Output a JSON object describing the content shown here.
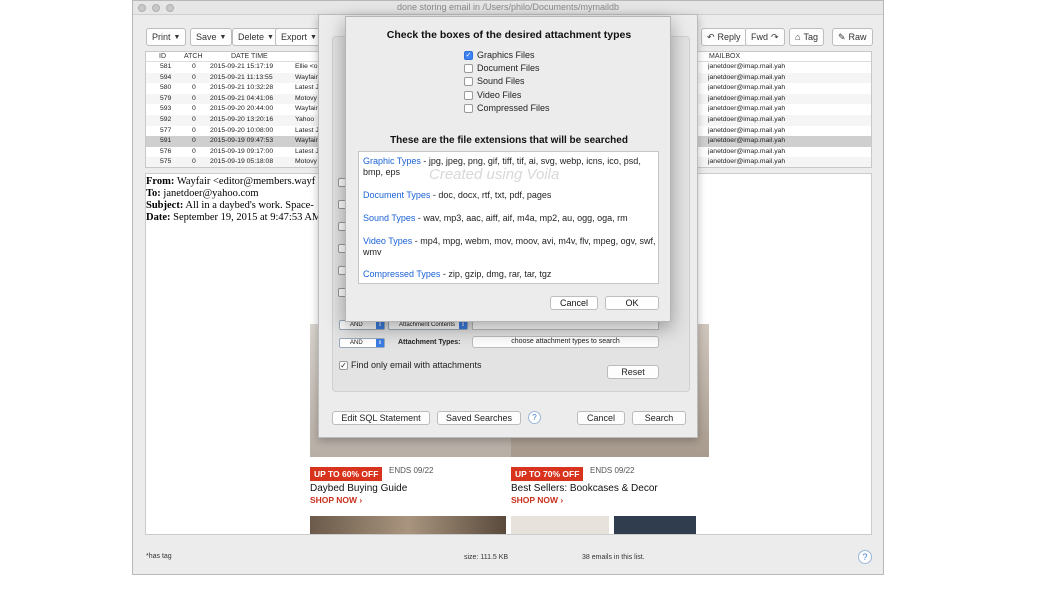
{
  "window": {
    "title": "done storing email in /Users/philo/Documents/mymaildb"
  },
  "toolbar": {
    "left": [
      "Print",
      "Save",
      "Delete",
      "Export"
    ],
    "right": [
      "Reply",
      "Fwd",
      "Tag",
      "Raw"
    ]
  },
  "list": {
    "headers": {
      "id": "ID",
      "atch": "ATCH",
      "date": "DATE TIME",
      "mailbox": "MAILBOX"
    },
    "rows": [
      {
        "id": "581",
        "atch": "0",
        "date": "2015-09-21 15:17:19",
        "from": "Ellie <o",
        "mailbox": "janetdoer@imap.mail.yah"
      },
      {
        "id": "594",
        "atch": "0",
        "date": "2015-09-21 11:13:55",
        "from": "Wayfair",
        "mailbox": "janetdoer@imap.mail.yah"
      },
      {
        "id": "580",
        "atch": "0",
        "date": "2015-09-21 10:32:28",
        "from": "Latest J",
        "mailbox": "janetdoer@imap.mail.yah"
      },
      {
        "id": "579",
        "atch": "0",
        "date": "2015-09-21 04:41:06",
        "from": "Motovy",
        "mailbox": "janetdoer@imap.mail.yah"
      },
      {
        "id": "593",
        "atch": "0",
        "date": "2015-09-20 20:44:00",
        "from": "Wayfair",
        "mailbox": "janetdoer@imap.mail.yah"
      },
      {
        "id": "592",
        "atch": "0",
        "date": "2015-09-20 13:20:16",
        "from": "Yahoo",
        "mailbox": "janetdoer@imap.mail.yah"
      },
      {
        "id": "577",
        "atch": "0",
        "date": "2015-09-20 10:08:00",
        "from": "Latest J",
        "mailbox": "janetdoer@imap.mail.yah"
      },
      {
        "id": "591",
        "atch": "0",
        "date": "2015-09-19 09:47:53",
        "from": "Wayfair",
        "mailbox": "janetdoer@imap.mail.yah",
        "selected": true
      },
      {
        "id": "576",
        "atch": "0",
        "date": "2015-09-19 09:17:00",
        "from": "Latest J",
        "mailbox": "janetdoer@imap.mail.yah"
      },
      {
        "id": "575",
        "atch": "0",
        "date": "2015-09-19 05:18:08",
        "from": "Motovy",
        "mailbox": "janetdoer@imap.mail.yah"
      }
    ]
  },
  "preview": {
    "from_label": "From:",
    "from": "Wayfair <editor@members.wayf",
    "to_label": "To:",
    "to": "janetdoer@yahoo.com",
    "subject_label": "Subject:",
    "subject": "All in a daybed's work. Space-",
    "date_label": "Date:",
    "date": "September 19, 2015 at 9:47:53 AM",
    "promos": [
      {
        "badge": "UP TO 60% OFF",
        "ends": "ENDS 09/22",
        "title": "Daybed Buying Guide",
        "cta": "SHOP NOW ›"
      },
      {
        "badge": "UP TO 70% OFF",
        "ends": "ENDS 09/22",
        "title": "Best Sellers: Bookcases & Decor",
        "cta": "SHOP NOW ›"
      }
    ]
  },
  "search": {
    "and1": "AND",
    "attachment_contents": "Attachment Contents",
    "and2": "AND",
    "attachment_types_label": "Attachment Types:",
    "choose_types": "choose attachment types to search",
    "find_only": "Find only email with attachments",
    "reset": "Reset",
    "edit_sql": "Edit SQL Statement",
    "saved_searches": "Saved Searches",
    "help": "?",
    "cancel": "Cancel",
    "search": "Search"
  },
  "dialog": {
    "title": "Check the boxes of the desired attachment types",
    "options": [
      {
        "label": "Graphics Files",
        "checked": true
      },
      {
        "label": "Document Files",
        "checked": false
      },
      {
        "label": "Sound Files",
        "checked": false
      },
      {
        "label": "Video Files",
        "checked": false
      },
      {
        "label": "Compressed Files",
        "checked": false
      }
    ],
    "ext_title": "These are the file extensions that will be searched",
    "watermark": "Created using Voila",
    "extensions": [
      {
        "cat": "Graphic Types",
        "list": " - jpg, jpeg, png, gif, tiff, tif, ai, svg, webp, icns, ico, psd, bmp, eps"
      },
      {
        "cat": "Document Types",
        "list": " - doc, docx, rtf, txt, pdf, pages"
      },
      {
        "cat": "Sound Types",
        "list": " - wav, mp3, aac, aiff, aif, m4a, mp2, au, ogg, oga, rm"
      },
      {
        "cat": "Video Types",
        "list": " - mp4, mpg, webm, mov, moov, avi, m4v, flv, mpeg, ogv, swf, wmv"
      },
      {
        "cat": "Compressed Types",
        "list": " - zip, gzip, dmg, rar, tar, tgz"
      }
    ],
    "cancel": "Cancel",
    "ok": "OK"
  },
  "status": {
    "tag_note": "*has tag",
    "size": "size: 111.5 KB",
    "count": "38 emails in this list.",
    "help": "?"
  }
}
